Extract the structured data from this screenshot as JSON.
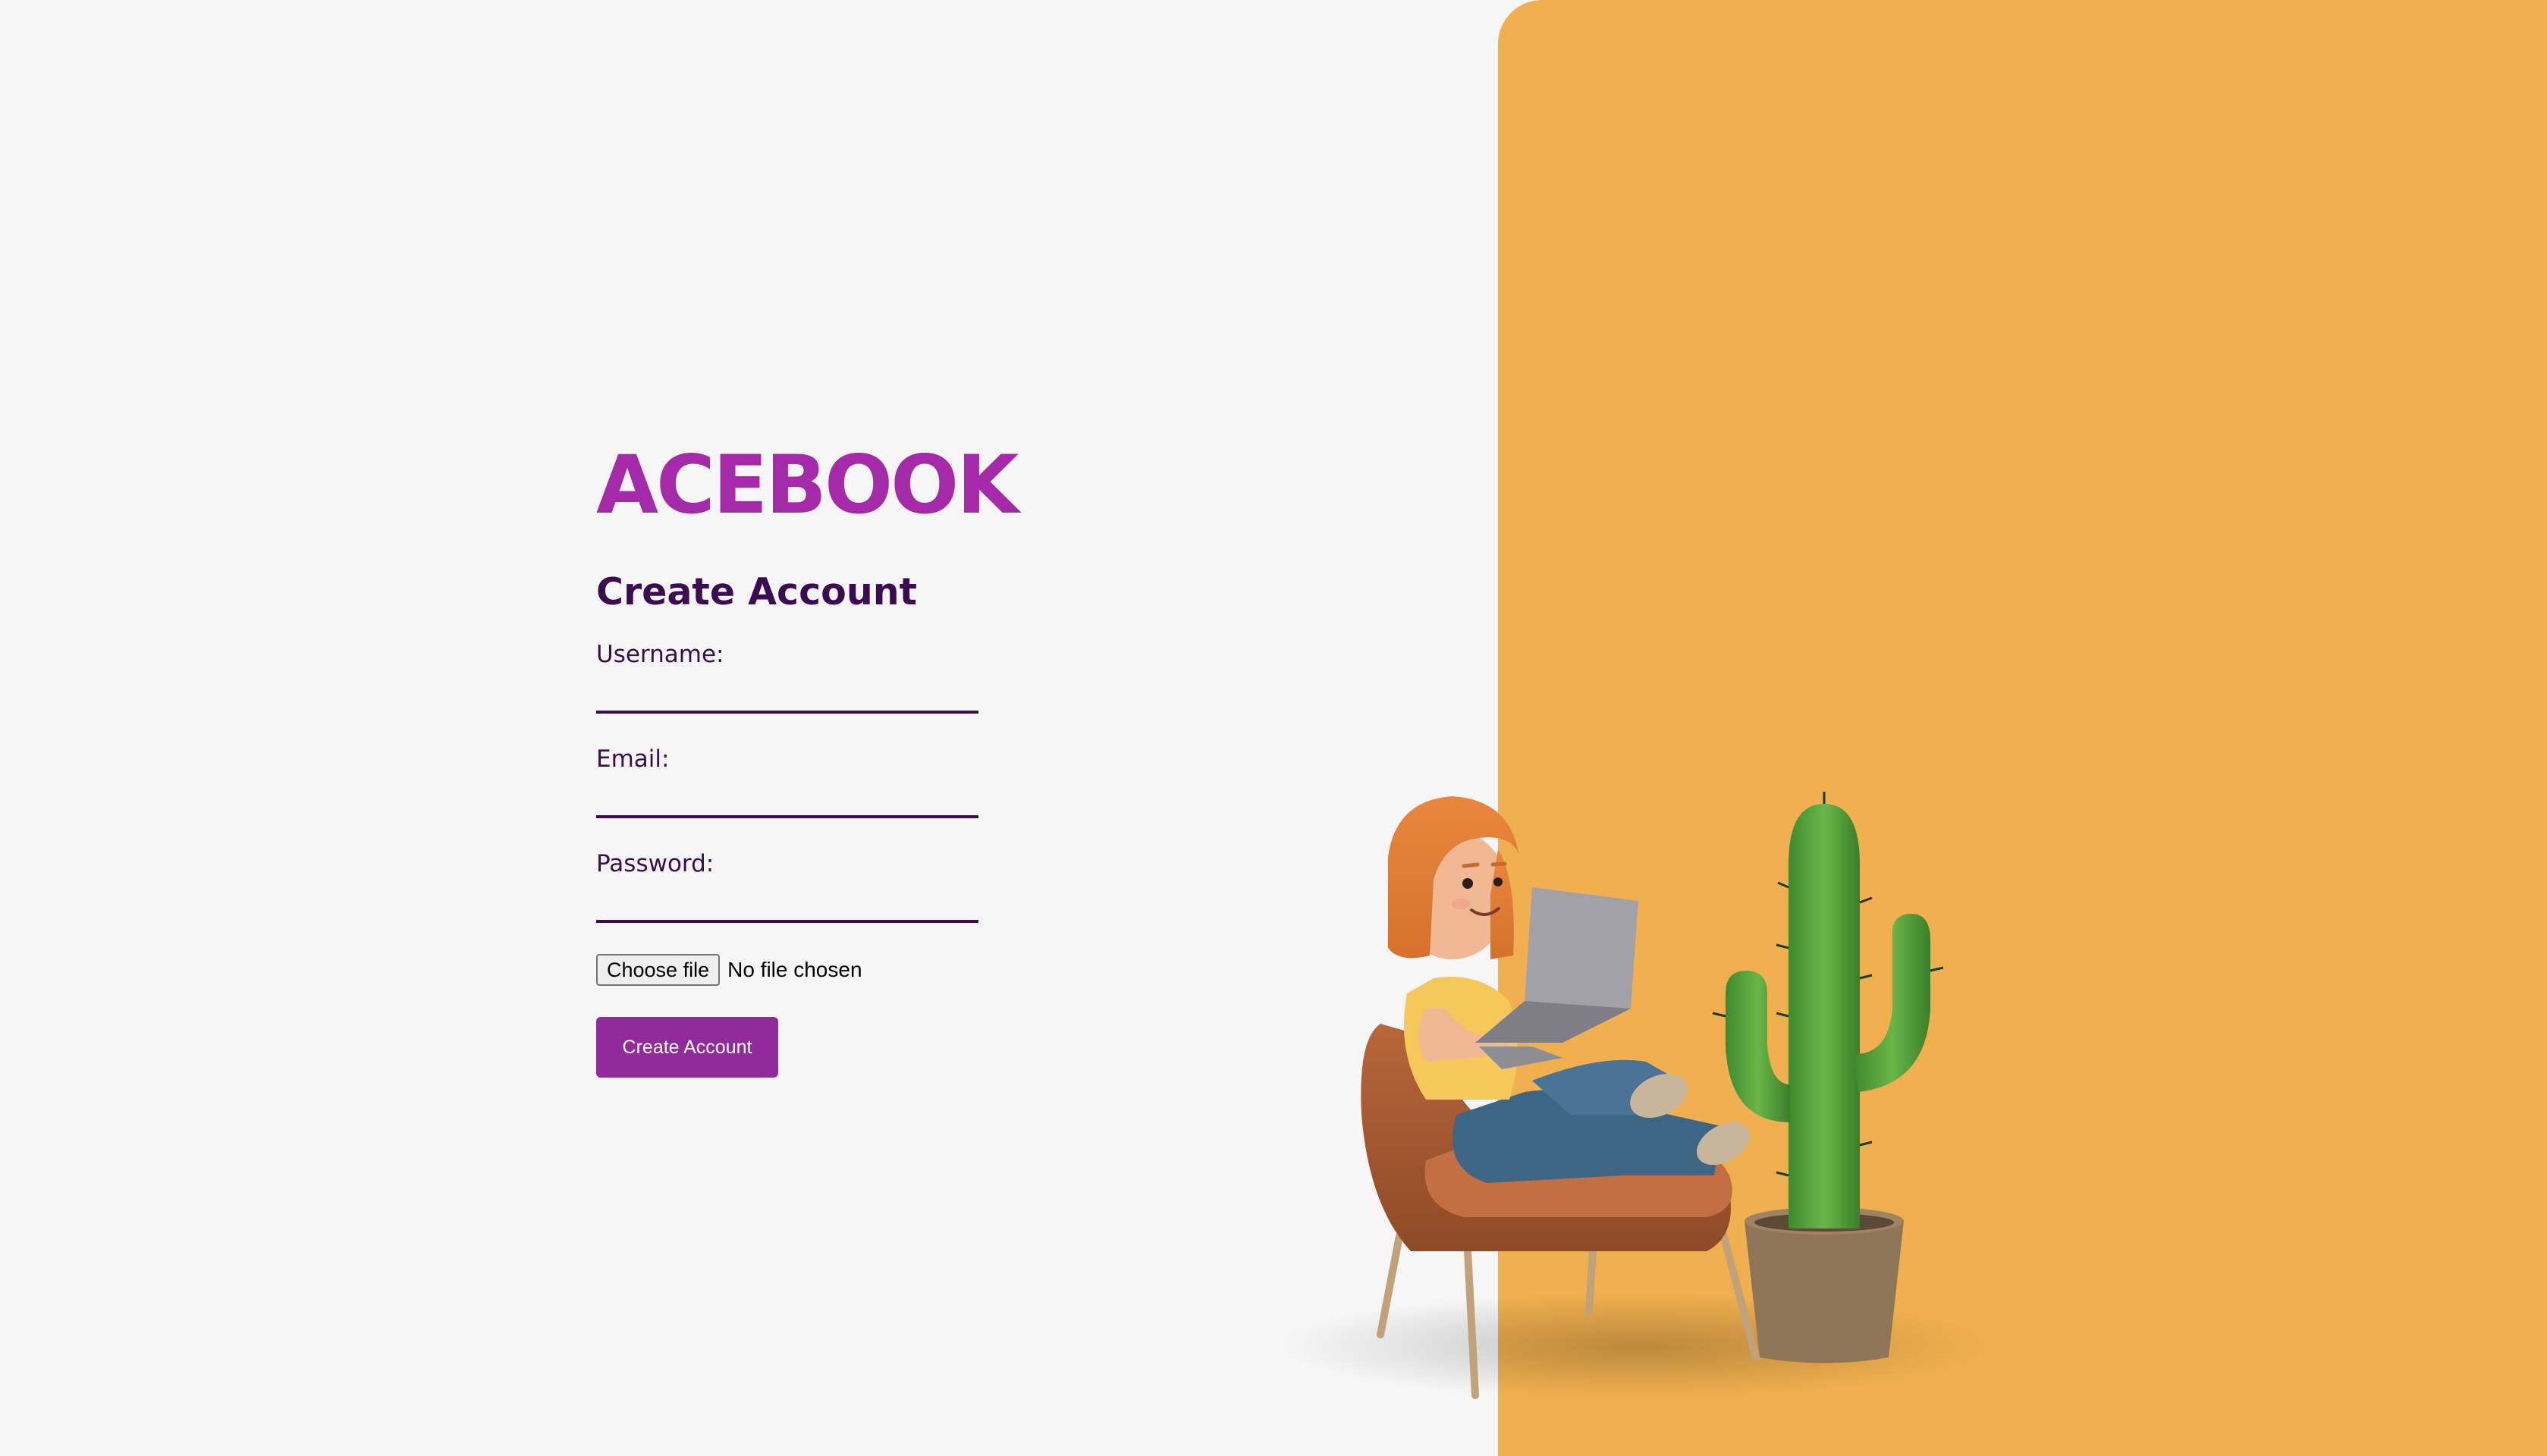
{
  "brand": {
    "logo_text": "ACEBOOK",
    "logo_color": "#a42aaa"
  },
  "form": {
    "title": "Create Account",
    "fields": [
      {
        "label": "Username:",
        "value": ""
      },
      {
        "label": "Email:",
        "value": ""
      },
      {
        "label": "Password:",
        "value": ""
      }
    ],
    "file_picker": {
      "button_label": "Choose file",
      "status_text": "No file chosen"
    },
    "submit_label": "Create Account"
  },
  "theme": {
    "page_background": "#f6f6f6",
    "panel_color": "#f1b04f",
    "text_color": "#3c0c50",
    "button_color": "#922a9c"
  },
  "illustration": {
    "icons": [
      "woman-with-laptop-illustration",
      "armchair-illustration",
      "potted-cactus-illustration"
    ]
  }
}
